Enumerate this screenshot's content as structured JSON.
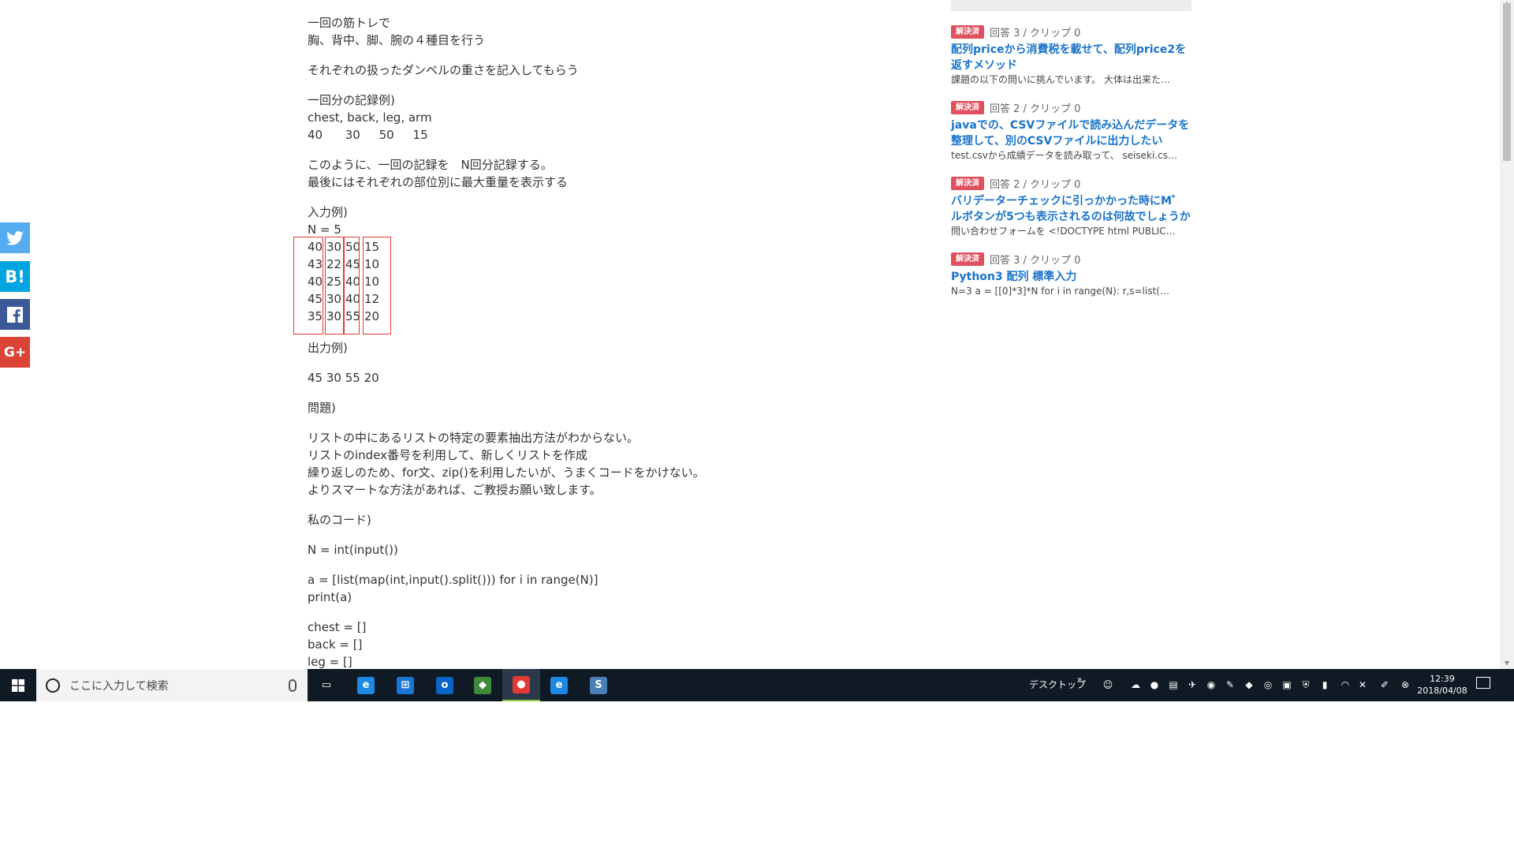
{
  "article": {
    "paras": [
      [
        "一回の筋トレで",
        "胸、背中、脚、腕の４種目を行う"
      ],
      [
        "それぞれの扱ったダンベルの重さを記入してもらう"
      ],
      [
        "一回分の記録例)",
        "chest, back, leg, arm",
        "40      30     50     15"
      ],
      [
        "このように、一回の記録を　N回分記録する。",
        "最後にはそれぞれの部位別に最大重量を表示する"
      ]
    ],
    "input_label": "入力例)",
    "n_line": "N = 5",
    "sample_rows": [
      [
        "40",
        "30",
        "50",
        "15"
      ],
      [
        "43",
        "22",
        "45",
        "10"
      ],
      [
        "40",
        "25",
        "40",
        "10"
      ],
      [
        "45",
        "30",
        "40",
        "12"
      ],
      [
        "35",
        "30",
        "55",
        "20"
      ]
    ],
    "paras2": [
      [
        "出力例)"
      ],
      [
        "45 30 55 20"
      ],
      [
        "問題)"
      ],
      [
        "リストの中にあるリストの特定の要素抽出方法がわからない。",
        "リストのindex番号を利用して、新しくリストを作成",
        "繰り返しのため、for文、zip()を利用したいが、うまくコードをかけない。",
        "よりスマートな方法があれば、ご教授お願い致します。"
      ],
      [
        "私のコード)"
      ],
      [
        "N = int(input())"
      ],
      [
        "a = [list(map(int,input().split())) for i in range(N)]",
        "print(a)"
      ],
      [
        "chest = []",
        "back = []",
        "leg = []"
      ]
    ]
  },
  "sidebar": {
    "items": [
      {
        "badge": "解決済",
        "meta": "回答 3 / クリップ 0",
        "title": "配列priceから消費税を載せて、配列price2を返すメソッド",
        "desc": "課題の以下の問いに挑んでいます。 大体は出来た…"
      },
      {
        "badge": "解決済",
        "meta": "回答 2 / クリップ 0",
        "title": "javaでの、CSVファイルで読み込んだデータを整理して、別のCSVファイルに出力したい",
        "desc": "test.csvから成績データを読み取って、 seiseki.cs…"
      },
      {
        "badge": "解決済",
        "meta": "回答 2 / クリップ 0",
        "title": "バリデーターチェックに引っかかった時にM゛ルボタンが5つも表示されるのは何故でしょうか",
        "desc": "問い合わせフォームを <!DOCTYPE html PUBLIC…"
      },
      {
        "badge": "解決済",
        "meta": "回答 3 / クリップ 0",
        "title": "Python3 配列 標準入力",
        "desc": "N=3 a = [[0]*3]*N for i in range(N): r,s=list(…"
      }
    ]
  },
  "social": {
    "twitter": "t",
    "hatena": "B!",
    "facebook": "f",
    "gplus": "G+"
  },
  "taskbar": {
    "search_placeholder": "ここに入力して検索",
    "desktop_label": "デスクトップ",
    "time": "12:39",
    "date": "2018/04/08",
    "apps": [
      {
        "name": "task-view",
        "color": "#0f1a24",
        "glyph": "▭"
      },
      {
        "name": "edge",
        "color": "#1e88e5",
        "glyph": "e"
      },
      {
        "name": "store",
        "color": "#1976d2",
        "glyph": "⊞"
      },
      {
        "name": "outlook",
        "color": "#0a64c8",
        "glyph": "o"
      },
      {
        "name": "app-green",
        "color": "#3d8b3d",
        "glyph": "◆"
      },
      {
        "name": "chrome",
        "color": "#e53935",
        "glyph": "●"
      },
      {
        "name": "ie",
        "color": "#1e88e5",
        "glyph": "e"
      },
      {
        "name": "editor",
        "color": "#4a7fb5",
        "glyph": "S"
      }
    ]
  }
}
